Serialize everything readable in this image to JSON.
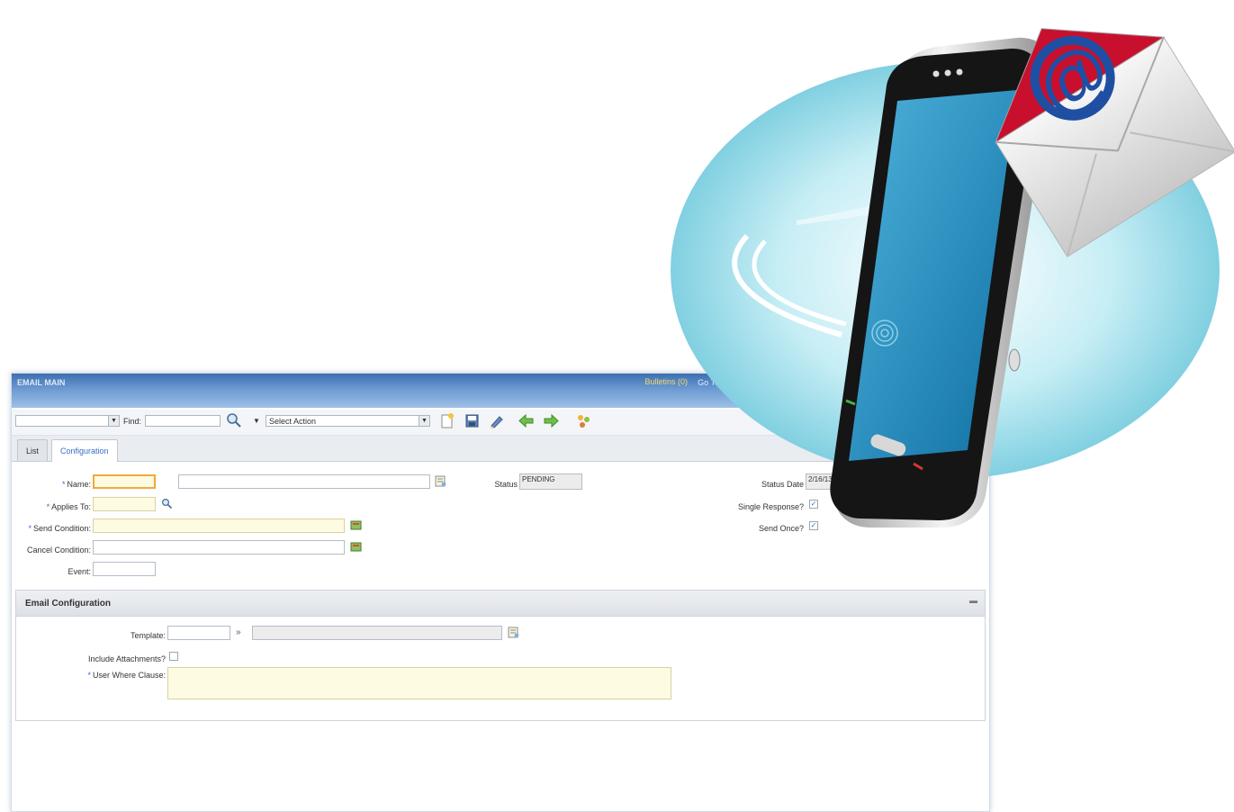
{
  "titlebar": {
    "app_name": "EMAIL MAIN",
    "bulletin": "Bulletins (0)",
    "go_to": "Go To"
  },
  "toolbar": {
    "find_label": "Find:",
    "find_value": "",
    "action_placeholder": "Select Action",
    "icons": [
      "new-record-icon",
      "save-icon",
      "edit-icon",
      "previous-arrow-icon",
      "next-arrow-icon",
      "workflow-icon"
    ]
  },
  "tabs": [
    {
      "label": "List",
      "active": false
    },
    {
      "label": "Configuration",
      "active": true
    }
  ],
  "form": {
    "name_label": "Name:",
    "applies_to_label": "Applies To:",
    "send_condition_label": "Send Condition:",
    "cancel_condition_label": "Cancel Condition:",
    "event_label": "Event:",
    "status_label": "Status",
    "status_value": "PENDING",
    "status_date_label": "Status Date",
    "status_date_value": "2/16/13 5:17 AM",
    "single_response_label": "Single Response?",
    "single_response_checked": true,
    "send_once_label": "Send Once?",
    "send_once_checked": true
  },
  "email_section": {
    "title": "Email Configuration",
    "template_label": "Template:",
    "include_attachments_label": "Include Attachments?",
    "include_attachments_checked": false,
    "user_where_label": "User Where Clause:"
  },
  "illustration": {
    "at_symbol": "@",
    "colors": {
      "bubble": "#8fd6e6",
      "envelope_flap": "#c8102e",
      "at": "#1f4fa3",
      "phone": "#1b1b1b"
    }
  }
}
